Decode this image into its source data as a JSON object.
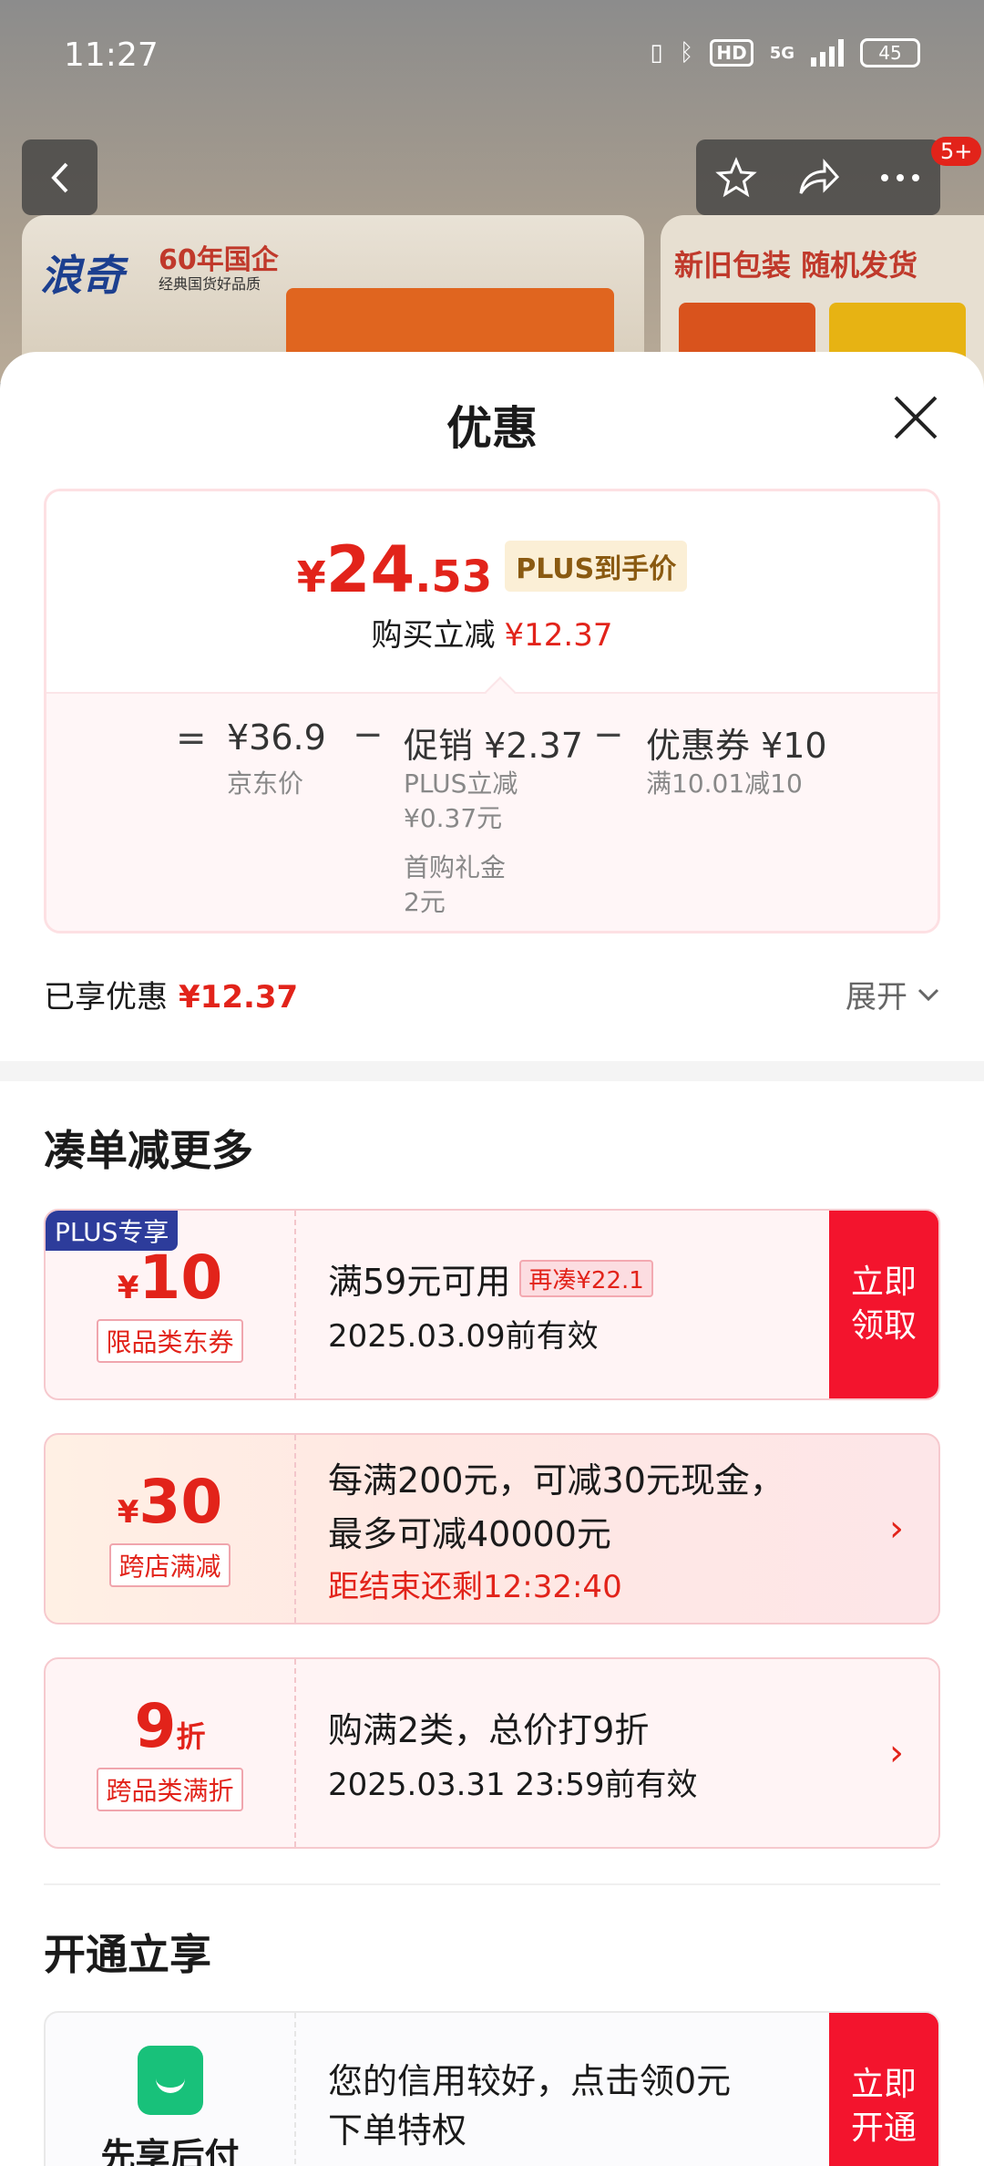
{
  "status": {
    "time": "11:27",
    "hd": "HD",
    "network": "5G",
    "battery": "45"
  },
  "header": {
    "badge": "5+"
  },
  "banner": {
    "brand": "浪奇",
    "brand_sub": "60年国企",
    "brand_tagline": "经典国货好品质",
    "right_text": "新旧包装 随机发货"
  },
  "sheet": {
    "title": "优惠",
    "price": {
      "currency": "¥",
      "integer": "24",
      "decimal": ".53",
      "tag": "PLUS到手价"
    },
    "instant": {
      "label": "购买立减",
      "value": "¥12.37"
    },
    "breakdown": {
      "eq": "=",
      "jd_price": "¥36.9",
      "jd_price_label": "京东价",
      "minus1": "−",
      "promo": "促销 ¥2.37",
      "promo_sub1": "PLUS立减",
      "promo_sub1b": "¥0.37元",
      "promo_sub2": "首购礼金",
      "promo_sub2b": "2元",
      "minus2": "−",
      "coupon": "优惠券 ¥10",
      "coupon_sub": "满10.01减10"
    },
    "enjoyed": {
      "label": "已享优惠",
      "value": "¥12.37"
    },
    "expand_label": "展开"
  },
  "more": {
    "title": "凑单减更多",
    "coupons": [
      {
        "flag": "PLUS专享",
        "currency": "¥",
        "amount": "10",
        "kind": "限品类东券",
        "line1": "满59元可用",
        "tag": "再凑¥22.1",
        "line2": "2025.03.09前有效",
        "cta": "立即领取"
      },
      {
        "currency": "¥",
        "amount": "30",
        "kind": "跨店满减",
        "line1": "每满200元，可减30元现金，",
        "line2": "最多可减40000元",
        "line3": "距结束还剩12:32:40"
      },
      {
        "amount": "9",
        "unit": "折",
        "kind": "跨品类满折",
        "line1": "购满2类，总价打9折",
        "line2": "2025.03.31 23:59前有效"
      }
    ]
  },
  "open": {
    "title": "开通立享",
    "card": {
      "name": "先享后付",
      "line1": "您的信用较好，点击领0元",
      "line2": "下单特权",
      "cta": "立即开通"
    }
  },
  "colors": {
    "accent": "#e2231a",
    "cta": "#f3142d",
    "plus": "#2d3c9b"
  }
}
